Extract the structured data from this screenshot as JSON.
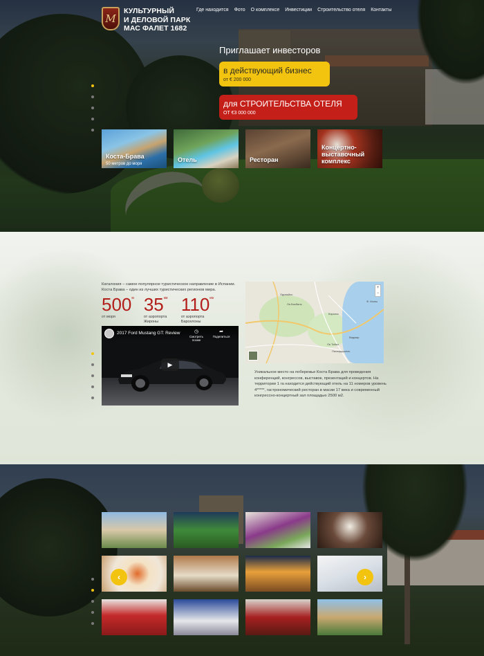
{
  "logo": {
    "monogram": "M",
    "line1": "Культурный",
    "line2": "и деловой парк",
    "line3": "Мас Фалет 1682"
  },
  "nav": [
    "Где находится",
    "Фото",
    "О комплексе",
    "Инвестиции",
    "Строительство отеля",
    "Контакты"
  ],
  "hero": {
    "heading": "Приглашает инвесторов",
    "cta_business": {
      "title": "в действующий бизнес",
      "price": "от € 200 000"
    },
    "cta_hotel": {
      "title": "для СТРОИТЕЛЬСТВА ОТЕЛЯ",
      "price": "ОТ €3 000 000"
    },
    "thumbs": [
      {
        "title": "Коста-Брава",
        "sub": "50 метров до моря"
      },
      {
        "title": "Отель",
        "sub": ""
      },
      {
        "title": "Ресторан",
        "sub": ""
      },
      {
        "title": "Концертно-\nвыставочный\nкомплекс",
        "sub": ""
      }
    ]
  },
  "info": {
    "intro": "Каталония – самое популярное туристическое направление в Испании. Коста Брава – один из лучших туристических регионов мира.",
    "stats": [
      {
        "value": "500",
        "unit": "м",
        "caption": "от моря"
      },
      {
        "value": "35",
        "unit": "км",
        "caption": "от аэропорта Жироны"
      },
      {
        "value": "110",
        "unit": "км",
        "caption": "от аэропорта Барселоны"
      }
    ],
    "video": {
      "title": "2017 Ford Mustang GT: Review",
      "watch_later": "Смотреть позже",
      "share": "Поделиться"
    },
    "map_labels": [
      "Одиньйос",
      "Ла Бисбаль",
      "Корсега",
      "Видмар",
      "Ф. Моны",
      "Ла Тойха",
      "Палафружель"
    ],
    "description": "Уникальное место на побережье Коста Брава для проведения конференций, конгрессов, выставок, презентаций и концертов. На территории 1 га находится действующий отель на 11 номеров уровень 4*****, гастрономический ресторан в масии 17 века и современный конгрессно-концертный зал площадью 2500 м2."
  },
  "colors": {
    "accent_yellow": "#f3c40f",
    "accent_red": "#c51f1a",
    "stat_red": "#b21e1a"
  },
  "icons": {
    "prev": "chevron-left-icon",
    "next": "chevron-right-icon",
    "play": "play-icon"
  },
  "gallery": {
    "prev_symbol": "‹",
    "next_symbol": "›"
  }
}
